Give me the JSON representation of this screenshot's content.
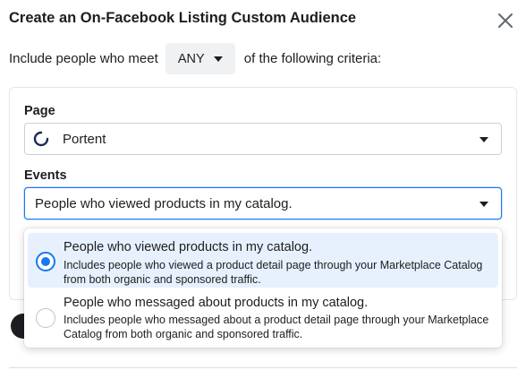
{
  "dialog": {
    "title": "Create an On-Facebook Listing Custom Audience"
  },
  "criteria": {
    "prefix": "Include people who meet",
    "match_value": "ANY",
    "suffix": "of the following criteria:"
  },
  "page_field": {
    "label": "Page",
    "value": "Portent"
  },
  "events_field": {
    "label": "Events",
    "value": "People who viewed products in my catalog."
  },
  "events_options": [
    {
      "title": "People who viewed products in my catalog.",
      "description": "Includes people who viewed a product detail page through your Marketplace Catalog from both organic and sponsored traffic.",
      "selected": true
    },
    {
      "title": "People who messaged about products in my catalog.",
      "description": "Includes people who messaged about a product detail page through your Marketplace Catalog from both organic and sponsored traffic.",
      "selected": false
    }
  ],
  "colors": {
    "accent": "#1877f2",
    "selected_bg": "#e7f0fd",
    "text": "#1c1e21"
  },
  "icons": [
    "close-icon",
    "chevron-down-icon",
    "page-logo-icon",
    "radio-checked-icon",
    "radio-unchecked-icon"
  ]
}
